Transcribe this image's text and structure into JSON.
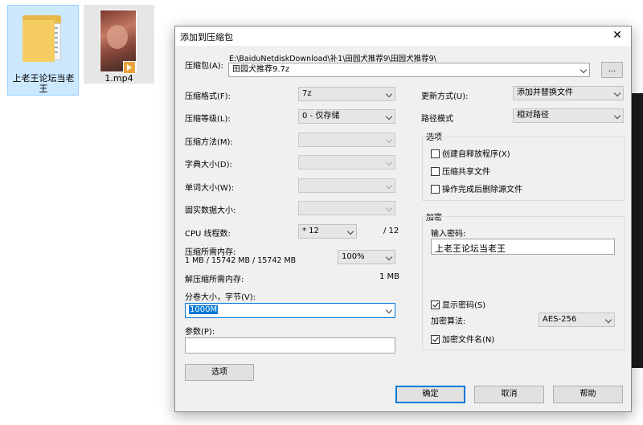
{
  "desktop": {
    "icons": [
      {
        "label": "上老王论坛当老王",
        "icon": "folder-icon",
        "selected": true
      },
      {
        "label": "1.mp4",
        "icon": "video-file-icon",
        "selected": false
      }
    ]
  },
  "dialog": {
    "title": "添加到压缩包",
    "close_glyph": "✕",
    "archive": {
      "label": "压缩包(A):",
      "path": "E:\\BaiduNetdiskDownload\\补1\\田园犬推荐9\\田园犬推荐9\\",
      "name": "田园犬推荐9.7z",
      "browse_label": "..."
    },
    "format": {
      "label": "压缩格式(F):",
      "value": "7z"
    },
    "level": {
      "label": "压缩等级(L):",
      "value": "0 - 仅存储"
    },
    "method": {
      "label": "压缩方法(M):",
      "value": ""
    },
    "dict_size": {
      "label": "字典大小(D):",
      "value": ""
    },
    "word_size": {
      "label": "单词大小(W):",
      "value": ""
    },
    "solid_size": {
      "label": "固实数据大小:",
      "value": ""
    },
    "cpu_threads": {
      "label": "CPU 线程数:",
      "value": "* 12",
      "max": "/ 12"
    },
    "compress_memory": {
      "label": "压缩所需内存:",
      "value": "1 MB / 15742 MB / 15742 MB",
      "percent": "100%"
    },
    "decompress_memory": {
      "label": "解压缩所需内存:",
      "value": "1 MB"
    },
    "volume": {
      "label": "分卷大小，字节(V):",
      "value": "1000M"
    },
    "params": {
      "label": "参数(P):",
      "value": ""
    },
    "options_button": "选项",
    "update_mode": {
      "label": "更新方式(U):",
      "value": "添加并替换文件"
    },
    "path_mode": {
      "label": "路径模式",
      "value": "相对路径"
    },
    "options_group": {
      "title": "选项",
      "checkboxes": [
        {
          "label": "创建自释放程序(X)",
          "checked": false
        },
        {
          "label": "压缩共享文件",
          "checked": false
        },
        {
          "label": "操作完成后删除源文件",
          "checked": false
        }
      ]
    },
    "encryption": {
      "title": "加密",
      "password_label": "输入密码:",
      "password_value": "上老王论坛当老王",
      "show_password": {
        "label": "显示密码(S)",
        "checked": true
      },
      "algorithm_label": "加密算法:",
      "algorithm_value": "AES-256",
      "encrypt_names": {
        "label": "加密文件名(N)",
        "checked": true
      }
    },
    "buttons": {
      "ok": "确定",
      "cancel": "取消",
      "help": "帮助"
    }
  }
}
